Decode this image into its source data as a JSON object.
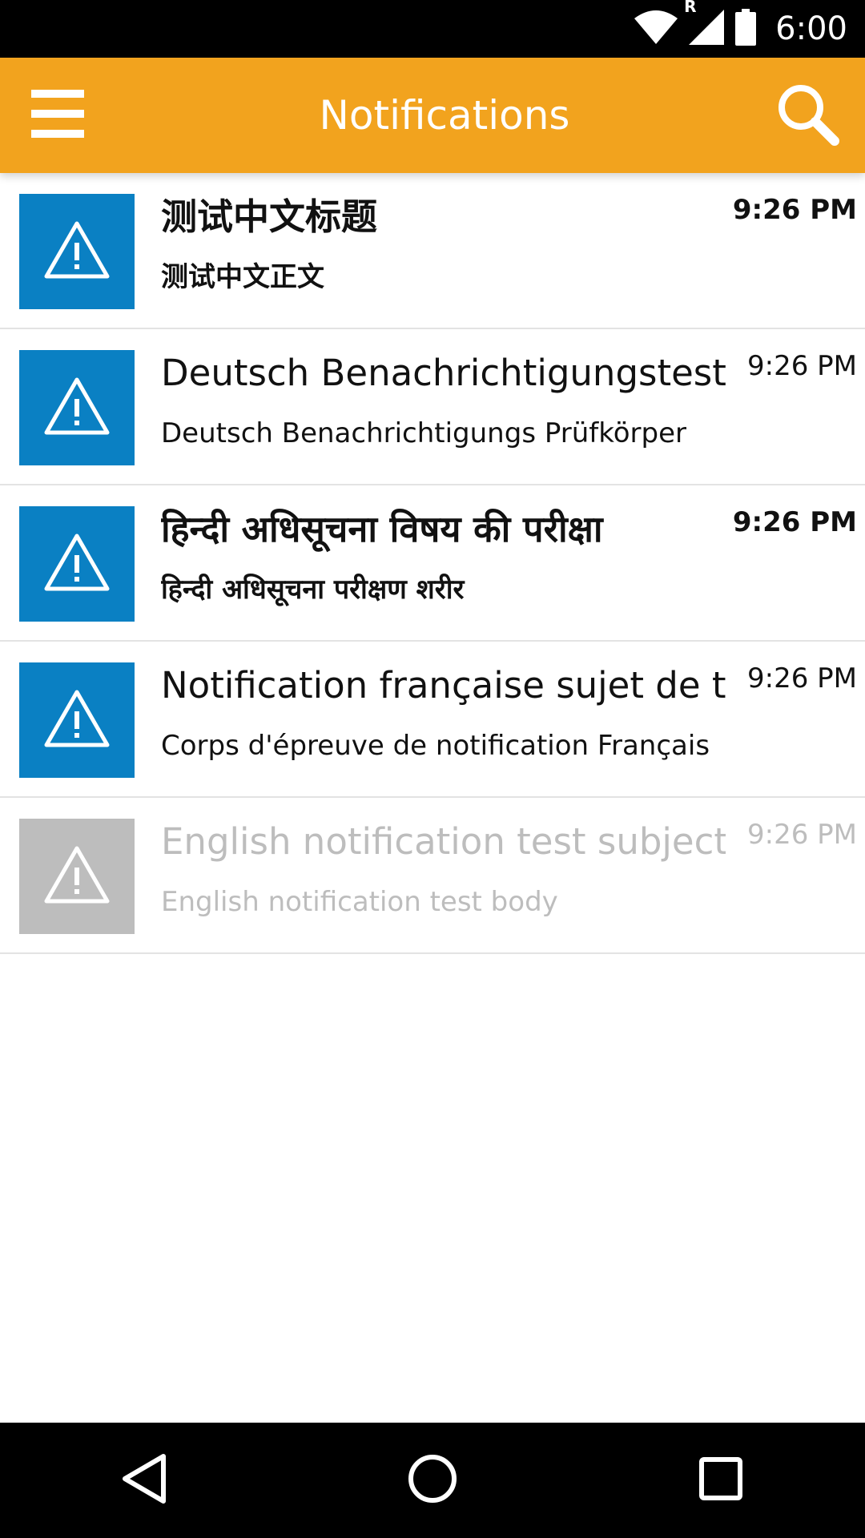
{
  "status_bar": {
    "time": "6:00",
    "icons": [
      "wifi-icon",
      "roaming-icon",
      "signal-icon",
      "battery-icon"
    ],
    "roaming_letter": "R"
  },
  "app_bar": {
    "title": "Notifications",
    "background": "#f2a31e",
    "left_icon": "menu-icon",
    "right_icon": "search-icon"
  },
  "notifications": [
    {
      "subject": "测试中文标题",
      "body": "测试中文正文",
      "time": "9:26 PM",
      "unread": true,
      "icon": "warning-icon"
    },
    {
      "subject": "Deutsch Benachrichtigungstest…",
      "body": "Deutsch Benachrichtigungs Prüfkörper",
      "time": "9:26 PM",
      "unread": false,
      "icon": "warning-icon"
    },
    {
      "subject": "हिन्दी अधिसूचना विषय की परीक्षा",
      "body": "हिन्दी अधिसूचना परीक्षण शरीर",
      "time": "9:26 PM",
      "unread": true,
      "icon": "warning-icon"
    },
    {
      "subject": "Notification française sujet de test",
      "body": "Corps d'épreuve de notification Français",
      "time": "9:26 PM",
      "unread": false,
      "icon": "warning-icon"
    },
    {
      "subject": "English notification test subject",
      "body": "English notification test body",
      "time": "9:26 PM",
      "unread": false,
      "read": true,
      "icon": "warning-icon"
    }
  ],
  "colors": {
    "accent": "#f2a31e",
    "icon_tile": "#0a80c3",
    "icon_tile_read": "#bdbdbd",
    "read_text": "#bdbdbd"
  },
  "nav_bar": {
    "icons": [
      "back-icon",
      "home-icon",
      "recents-icon"
    ]
  }
}
